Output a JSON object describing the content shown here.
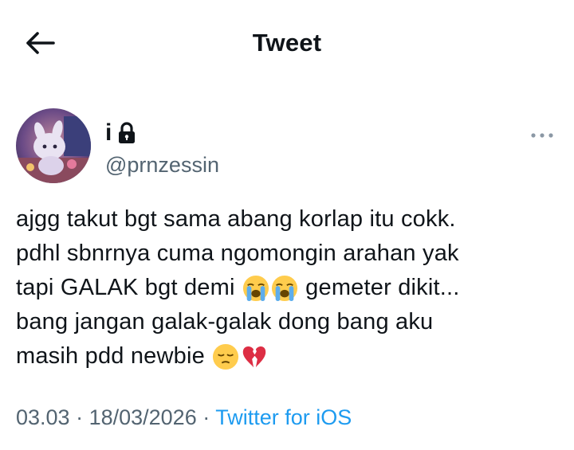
{
  "header": {
    "title": "Tweet",
    "back_icon": "arrow-left-icon"
  },
  "author": {
    "display_name": "i",
    "protected_icon": "lock-icon",
    "handle": "@prnzessin",
    "avatar_icon": "avatar-photo"
  },
  "more_icon": "more-horizontal-icon",
  "tweet": {
    "line1": "ajgg takut bgt sama abang korlap itu cokk.",
    "line2": "pdhl sbnrnya cuma ngomongin arahan yak",
    "line3_a": "tapi GALAK bgt demi",
    "line3_b": "gemeter dikit...",
    "line4": "bang jangan galak-galak dong bang aku",
    "line5": "masih pdd newbie",
    "emojis": [
      "loudly-crying-face",
      "loudly-crying-face",
      "pensive-face",
      "broken-heart"
    ]
  },
  "meta": {
    "time": "03.03",
    "sep1": " · ",
    "date": "18/03/2026",
    "sep2": " · ",
    "source": "Twitter for iOS"
  },
  "colors": {
    "text": "#0f1419",
    "secondary": "#536471",
    "link": "#1d9bf0"
  }
}
